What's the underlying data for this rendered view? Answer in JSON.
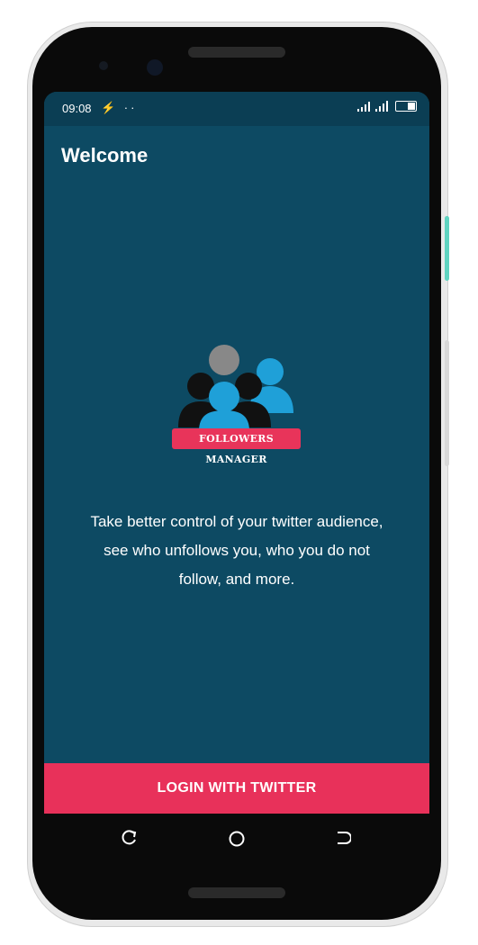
{
  "status_bar": {
    "time": "09:08",
    "left_icons": "⚡ ··",
    "signal_icon": "signal-icon",
    "battery_icon": "battery-icon"
  },
  "header": {
    "title": "Welcome"
  },
  "logo": {
    "badge_text": "FOLLOWERS MANAGER"
  },
  "description": "Take better control of your twitter audience, see who unfollows you, who you do not follow, and more.",
  "login_button": {
    "label": "LOGIN WITH TWITTER"
  },
  "navigation": {
    "recent_icon": "recent-apps-icon",
    "home_icon": "home-icon",
    "back_icon": "back-icon"
  },
  "colors": {
    "screen_bg": "#0d4a63",
    "status_bg": "#0b3e54",
    "accent": "#e8315a",
    "logo_blue": "#1fa0d8",
    "logo_grey": "#888888",
    "logo_black": "#111111"
  }
}
